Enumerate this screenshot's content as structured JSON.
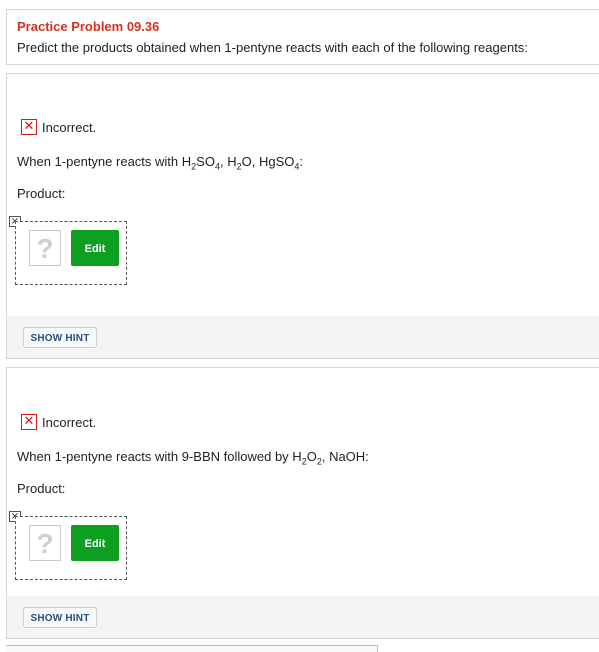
{
  "header": {
    "title": "Practice Problem 09.36",
    "subtitle": "Predict the products obtained when 1-pentyne reacts with each of the following reagents:"
  },
  "parts": [
    {
      "status": "Incorrect.",
      "question": {
        "prefix": "When 1-pentyne reacts with H",
        "s1": "2",
        "m1": "SO",
        "s2": "4",
        "m2": ", H",
        "s3": "2",
        "m3": "O, HgSO",
        "s4": "4",
        "suffix": ":"
      },
      "product_label": "Product:",
      "placeholder": "?",
      "edit_label": "Edit",
      "hint_label": "SHOW HINT"
    },
    {
      "status": "Incorrect.",
      "question": {
        "prefix": "When 1-pentyne reacts with 9-BBN followed by H",
        "s1": "2",
        "m1": "O",
        "s2": "2",
        "suffix": ", NaOH:"
      },
      "product_label": "Product:",
      "placeholder": "?",
      "edit_label": "Edit",
      "hint_label": "SHOW HINT"
    }
  ],
  "icons": {
    "incorrect": "x-mark-icon",
    "broken_image": "broken-image-icon"
  },
  "colors": {
    "title": "#d4321f",
    "edit": "#0e9f20",
    "incorrect": "#cc2020",
    "hint_text": "#2a4f7c"
  }
}
